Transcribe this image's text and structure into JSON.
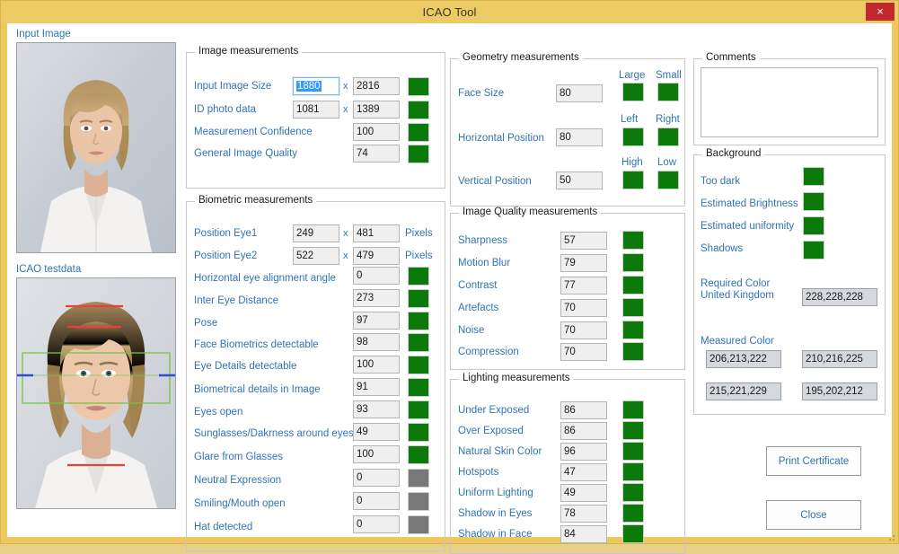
{
  "window": {
    "title": "ICAO Tool",
    "close_label": "×",
    "accent_title_bg": "#eccb65",
    "close_bg": "#c1292e",
    "label_color": "#2f74b5",
    "indicator_green": "#0b7a0b",
    "indicator_gray": "#787878"
  },
  "left_panel": {
    "input_image_label": "Input Image",
    "testdata_label": "ICAO testdata"
  },
  "image_measurements": {
    "title": "Image measurements",
    "rows": [
      {
        "label": "Input Image Size",
        "value": "1880",
        "value2": "2816",
        "sep": "x",
        "selected": true,
        "indicator": "green"
      },
      {
        "label": "ID photo data",
        "value": "1081",
        "value2": "1389",
        "sep": "x",
        "selected": false,
        "indicator": "green"
      },
      {
        "label": "Measurement Confidence",
        "value": "100",
        "value2": "",
        "sep": "",
        "selected": false,
        "indicator": "green"
      },
      {
        "label": "General Image Quality",
        "value": "74",
        "value2": "",
        "sep": "",
        "selected": false,
        "indicator": "green"
      }
    ]
  },
  "biometric_measurements": {
    "title": "Biometric measurements",
    "unit_label": "Pixels",
    "rows": [
      {
        "label": "Position Eye1",
        "value": "249",
        "value2": "481",
        "sep": "x",
        "unit": "Pixels",
        "indicator": ""
      },
      {
        "label": "Position Eye2",
        "value": "522",
        "value2": "479",
        "sep": "x",
        "unit": "Pixels",
        "indicator": ""
      },
      {
        "label": "Horizontal eye alignment angle",
        "value": "0",
        "value2": "",
        "sep": "",
        "unit": "",
        "indicator": "green"
      },
      {
        "label": "Inter Eye Distance",
        "value": "273",
        "value2": "",
        "sep": "",
        "unit": "",
        "indicator": "green"
      },
      {
        "label": "Pose",
        "value": "97",
        "value2": "",
        "sep": "",
        "unit": "",
        "indicator": "green"
      },
      {
        "label": "Face Biometrics detectable",
        "value": "98",
        "value2": "",
        "sep": "",
        "unit": "",
        "indicator": "green"
      },
      {
        "label": "Eye Details detectable",
        "value": "100",
        "value2": "",
        "sep": "",
        "unit": "",
        "indicator": "green"
      },
      {
        "label": "Biometrical details in Image",
        "value": "91",
        "value2": "",
        "sep": "",
        "unit": "",
        "indicator": "green"
      },
      {
        "label": "Eyes open",
        "value": "93",
        "value2": "",
        "sep": "",
        "unit": "",
        "indicator": "green"
      },
      {
        "label": "Sunglasses/Dakrness around eyes",
        "value": "49",
        "value2": "",
        "sep": "",
        "unit": "",
        "indicator": "green"
      },
      {
        "label": "Glare from Glasses",
        "value": "100",
        "value2": "",
        "sep": "",
        "unit": "",
        "indicator": "green"
      },
      {
        "label": "Neutral Expression",
        "value": "0",
        "value2": "",
        "sep": "",
        "unit": "",
        "indicator": "gray"
      },
      {
        "label": "Smiling/Mouth open",
        "value": "0",
        "value2": "",
        "sep": "",
        "unit": "",
        "indicator": "gray"
      },
      {
        "label": "Hat detected",
        "value": "0",
        "value2": "",
        "sep": "",
        "unit": "",
        "indicator": "gray"
      }
    ]
  },
  "geometry_measurements": {
    "title": "Geometry measurements",
    "rows": [
      {
        "label": "Face Size",
        "value": "80",
        "head_left": "Large",
        "head_right": "Small",
        "ind_left": "green",
        "ind_right": "green"
      },
      {
        "label": "Horizontal Position",
        "value": "80",
        "head_left": "Left",
        "head_right": "Right",
        "ind_left": "green",
        "ind_right": "green"
      },
      {
        "label": "Vertical Position",
        "value": "50",
        "head_left": "High",
        "head_right": "Low",
        "ind_left": "green",
        "ind_right": "green"
      }
    ]
  },
  "image_quality_measurements": {
    "title": "Image Quality measurements",
    "rows": [
      {
        "label": "Sharpness",
        "value": "57",
        "indicator": "green"
      },
      {
        "label": "Motion Blur",
        "value": "79",
        "indicator": "green"
      },
      {
        "label": "Contrast",
        "value": "77",
        "indicator": "green"
      },
      {
        "label": "Artefacts",
        "value": "70",
        "indicator": "green"
      },
      {
        "label": "Noise",
        "value": "70",
        "indicator": "green"
      },
      {
        "label": "Compression",
        "value": "70",
        "indicator": "green"
      }
    ]
  },
  "lighting_measurements": {
    "title": "Lighting measurements",
    "rows": [
      {
        "label": "Under Exposed",
        "value": "86",
        "indicator": "green"
      },
      {
        "label": "Over Exposed",
        "value": "86",
        "indicator": "green"
      },
      {
        "label": "Natural Skin Color",
        "value": "96",
        "indicator": "green"
      },
      {
        "label": "Hotspots",
        "value": "47",
        "indicator": "green"
      },
      {
        "label": "Uniform Lighting",
        "value": "49",
        "indicator": "green"
      },
      {
        "label": "Shadow in Eyes",
        "value": "78",
        "indicator": "green"
      },
      {
        "label": "Shadow in Face",
        "value": "84",
        "indicator": "green"
      }
    ]
  },
  "comments": {
    "title": "Comments",
    "value": "",
    "placeholder": ""
  },
  "background": {
    "title": "Background",
    "rows": [
      {
        "label": "Too dark",
        "indicator": "green"
      },
      {
        "label": "Estimated Brightness",
        "indicator": "green"
      },
      {
        "label": "Estimated uniformity",
        "indicator": "green"
      },
      {
        "label": "Shadows",
        "indicator": "green"
      }
    ],
    "required_color_label_1": "Required Color",
    "required_color_label_2": "United Kingdom",
    "required_color_value": "228,228,228",
    "measured_color_label": "Measured Color",
    "measured_colors": [
      "206,213,222",
      "210,216,225",
      "215,221,229",
      "195,202,212"
    ]
  },
  "buttons": {
    "print_certificate": "Print Certificate",
    "close": "Close"
  }
}
